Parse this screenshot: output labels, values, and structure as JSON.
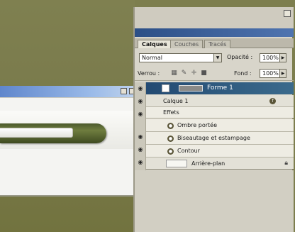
{
  "layers_panel": {
    "tabs": [
      "Calques",
      "Couches",
      "Tracés"
    ],
    "blend_mode": "Normal",
    "opacity_label": "Opacité :",
    "opacity_value": "100%",
    "lock_label": "Verrou :",
    "fill_label": "Fond :",
    "fill_value": "100%",
    "selected_layer": "Forme 1",
    "layer_style_group": "Calque 1",
    "effects_label": "Effets",
    "effects": [
      "Ombre portée",
      "Biseautage et estampage",
      "Contour"
    ],
    "bottom_layer": "Arrière-plan"
  },
  "icons": {
    "visibility": "eye-icon",
    "effect": "fx-icon",
    "lock": "lock-icon",
    "move": "move-icon",
    "brush": "brush-icon"
  },
  "colors": {
    "selection": "#234a72",
    "desktop": "#7d7e4e",
    "shape": "#4c5a2c"
  }
}
